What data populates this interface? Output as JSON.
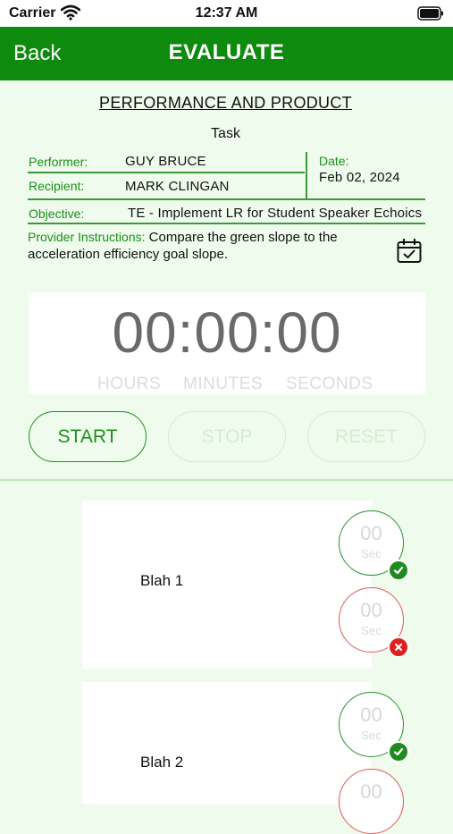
{
  "status": {
    "carrier": "Carrier",
    "time": "12:37 AM"
  },
  "nav": {
    "back_label": "Back",
    "title": "EVALUATE"
  },
  "header": {
    "section_title": "PERFORMANCE AND PRODUCT",
    "task_label": "Task"
  },
  "info": {
    "performer_label": "Performer:",
    "performer": "GUY BRUCE",
    "recipient_label": "Recipient:",
    "recipient": "MARK CLINGAN",
    "date_label": "Date:",
    "date": "Feb 02, 2024",
    "objective_label": "Objective:",
    "objective": "TE - Implement LR for Student Speaker Echoics",
    "instructions_label": "Provider Instructions:",
    "instructions": "Compare the green slope to the acceleration efficiency goal slope."
  },
  "timer": {
    "display": "00:00:00",
    "hours_label": "HOURS",
    "minutes_label": "MINUTES",
    "seconds_label": "SECONDS"
  },
  "controls": {
    "start": "START",
    "stop": "STOP",
    "reset": "RESET"
  },
  "items": [
    {
      "label": "Blah 1",
      "correct": "00",
      "incorrect": "00",
      "unit": "Sec"
    },
    {
      "label": "Blah 2",
      "correct": "00",
      "incorrect": "00",
      "unit": "Sec"
    }
  ],
  "colors": {
    "primary": "#0e8a0e",
    "background": "#effbec",
    "error": "#e02020"
  }
}
